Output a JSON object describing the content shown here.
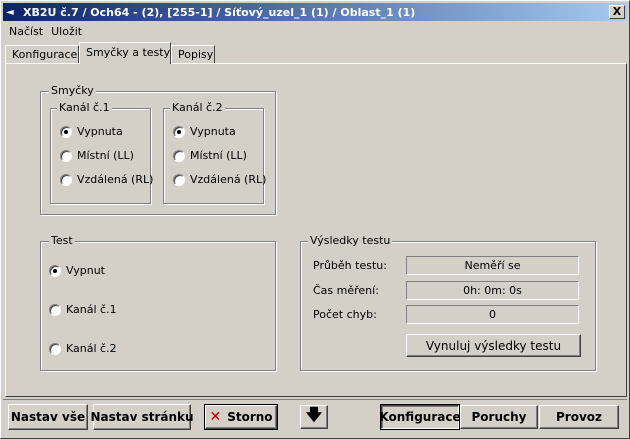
{
  "window": {
    "title": "XB2U č.7 / Och64 - (2), [255-1] / Síťový_uzel_1 (1) / Oblast_1 (1)",
    "close": "X"
  },
  "menu": [
    "Načíst",
    "Uložit"
  ],
  "tabs": [
    "Konfigurace",
    "Smyčky a testy",
    "Popisy"
  ],
  "active_tab": "Smyčky a testy",
  "loops": {
    "title": "Smyčky",
    "ch1": {
      "title": "Kanál č.1",
      "options": [
        "Vypnuta",
        "Místní (LL)",
        "Vzdálená (RL)"
      ],
      "selected": "Vypnuta"
    },
    "ch2": {
      "title": "Kanál č.2",
      "options": [
        "Vypnuta",
        "Místní (LL)",
        "Vzdálená (RL)"
      ],
      "selected": "Vypnuta"
    }
  },
  "test": {
    "title": "Test",
    "options": [
      "Vypnut",
      "Kanál č.1",
      "Kanál č.2"
    ],
    "selected": "Vypnut"
  },
  "results": {
    "title": "Výsledky testu",
    "progress_label": "Průběh testu:",
    "progress_value": "Neměří se",
    "time_label": "Čas měření:",
    "time_value": "0h: 0m: 0s",
    "errors_label": "Počet chyb:",
    "errors_value": "0",
    "reset_button": "Vynuluj výsledky testu"
  },
  "bottom": {
    "set_all": "Nastav vše",
    "set_page": "Nastav stránku",
    "cancel": "Storno",
    "configuration": "Konfigurace",
    "faults": "Poruchy",
    "operation": "Provoz"
  }
}
